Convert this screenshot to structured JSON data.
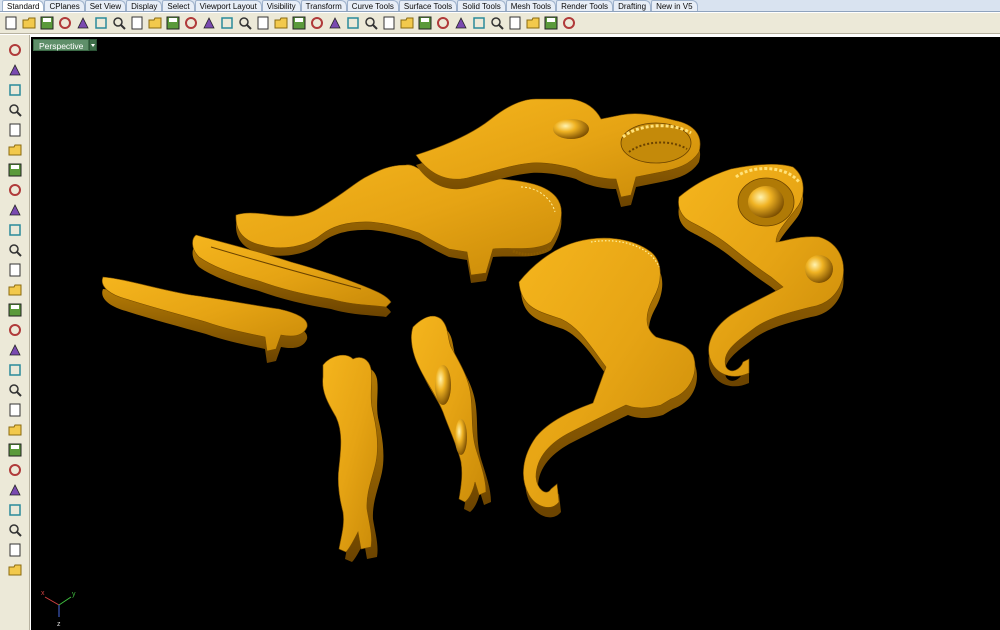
{
  "tabs": [
    "Standard",
    "CPlanes",
    "Set View",
    "Display",
    "Select",
    "Viewport Layout",
    "Visibility",
    "Transform",
    "Curve Tools",
    "Surface Tools",
    "Solid Tools",
    "Mesh Tools",
    "Render Tools",
    "Drafting",
    "New in V5"
  ],
  "toolbar_icons": [
    "new-icon",
    "open-icon",
    "save-icon",
    "print-icon",
    "import-icon",
    "cut-icon",
    "copy-icon",
    "paste-icon",
    "undo-icon",
    "pan-icon",
    "rotate-view-icon",
    "zoom-icon",
    "zoom-window-icon",
    "zoom-extents-icon",
    "zoom-selected-icon",
    "rotate-icon",
    "viewport-layout-icon",
    "select-icon",
    "hide-icon",
    "show-icon",
    "lock-icon",
    "light-icon",
    "shade-icon",
    "render-icon",
    "color-wheel-icon",
    "material-icon",
    "sphere-icon",
    "environment-icon",
    "layer-icon",
    "options-icon",
    "properties-icon",
    "help-icon"
  ],
  "left_icons": [
    "arrow-select-icon",
    "point-icon",
    "polyline-icon",
    "curve-icon",
    "circle-icon",
    "ellipse-icon",
    "arc-icon",
    "rectangle-icon",
    "polygon-icon",
    "fillet-icon",
    "extend-icon",
    "surface-icon",
    "box-icon",
    "sphere-solid-icon",
    "cylinder-icon",
    "mesh-icon",
    "transform-icon",
    "boolean-icon",
    "array-icon",
    "dimension-icon",
    "rotate-tool-icon",
    "split-icon",
    "text-icon",
    "group-icon",
    "snap-icon",
    "analyze-icon",
    "render-solid-icon"
  ],
  "viewport": {
    "label": "Perspective"
  },
  "axes": {
    "x": "x",
    "y": "y",
    "z": "z"
  },
  "colors": {
    "model_gold": "#e6a414",
    "model_dark": "#8a5a00",
    "model_highlight": "#ffd75a",
    "viewport_bg": "#000000",
    "viewport_label_bg": "#5f8f6a"
  }
}
